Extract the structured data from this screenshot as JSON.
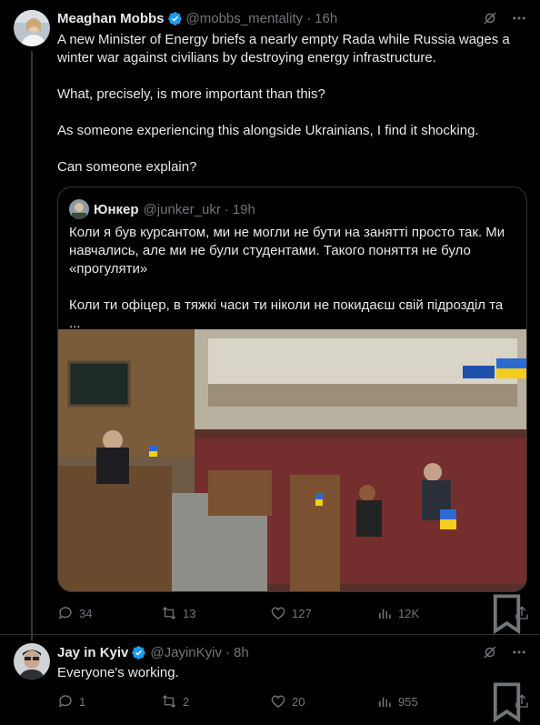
{
  "tweet1": {
    "author_name": "Meaghan Mobbs",
    "handle": "@mobbs_mentality",
    "time": "16h",
    "paragraphs": [
      "A new Minister of Energy briefs a nearly empty Rada while Russia wages a winter war against civilians by destroying energy infrastructure.",
      "What, precisely, is more important than this?",
      "As someone experiencing this alongside Ukrainians, I find it shocking.",
      "Can someone explain?"
    ],
    "quote": {
      "author_name": "Юнкер",
      "handle": "@junker_ukr",
      "time": "19h",
      "paragraphs": [
        "Коли я був курсантом, ми не могли не бути на занятті просто так. Ми навчались, але ми не були студентами. Такого поняття не було «прогуляти»",
        "Коли ти офіцер, в тяжкі часи ти ніколи не покидаєш свій підрозділ та ..."
      ]
    },
    "actions": {
      "replies": "34",
      "reposts": "13",
      "likes": "127",
      "views": "12K"
    }
  },
  "tweet2": {
    "author_name": "Jay in Kyiv",
    "handle": "@JayinKyiv",
    "time": "8h",
    "text": "Everyone's working.",
    "actions": {
      "replies": "1",
      "reposts": "2",
      "likes": "20",
      "views": "955"
    }
  },
  "separator": "·",
  "colors": {
    "background": "#000000",
    "text": "#e7e9ea",
    "muted": "#71767b",
    "verified": "#1d9bf0",
    "border": "#2f3336"
  }
}
